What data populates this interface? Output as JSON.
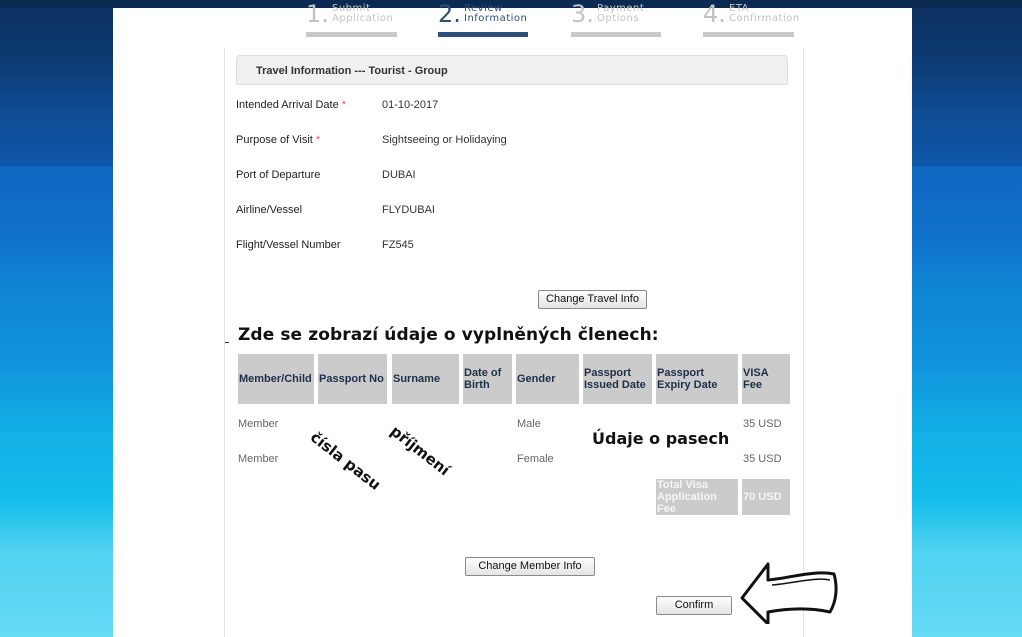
{
  "steps": [
    {
      "num": "1.",
      "line1": "Submit",
      "line2": "Application",
      "active": false
    },
    {
      "num": "2.",
      "line1": "Review",
      "line2": "Information",
      "active": true
    },
    {
      "num": "3.",
      "line1": "Payment",
      "line2": "Options",
      "active": false
    },
    {
      "num": "4.",
      "line1": "ETA",
      "line2": "Confirmation",
      "active": false
    }
  ],
  "travel": {
    "header": "Travel Information --- Tourist - Group",
    "fields": [
      {
        "label": "Intended Arrival Date",
        "required": "*",
        "value": "01-10-2017"
      },
      {
        "label": "Purpose of Visit",
        "required": "*",
        "value": "Sightseeing or Holidaying"
      },
      {
        "label": "Port of Departure",
        "required": "",
        "value": "DUBAI"
      },
      {
        "label": "Airline/Vessel",
        "required": "",
        "value": "FLYDUBAI"
      },
      {
        "label": "Flight/Vessel Number",
        "required": "",
        "value": "FZ545"
      }
    ],
    "change_button": "Change Travel Info"
  },
  "annotation": {
    "title": "Zde se zobrazí údaje o vyplněných členech:",
    "passport_no": "čísla pasu",
    "surname": "příjmení",
    "passport_details": "Údaje o pasech"
  },
  "members": {
    "headers": [
      "Member/Child",
      "Passport No",
      "Surname",
      "Date of Birth",
      "Gender",
      "Passport Issued Date",
      "Passport Expiry Date",
      "VISA Fee"
    ],
    "rows": [
      {
        "type": "Member",
        "gender": "Male",
        "fee": "35 USD"
      },
      {
        "type": "Member",
        "gender": "Female",
        "fee": "35 USD"
      }
    ],
    "total_label": "Total Visa Application Fee",
    "total_value": "70 USD",
    "change_button": "Change Member Info"
  },
  "confirm_button": "Confirm",
  "colors": {
    "accent": "#2f4f7d",
    "required": "#e0603a",
    "table_header": "#cbcbcb"
  }
}
